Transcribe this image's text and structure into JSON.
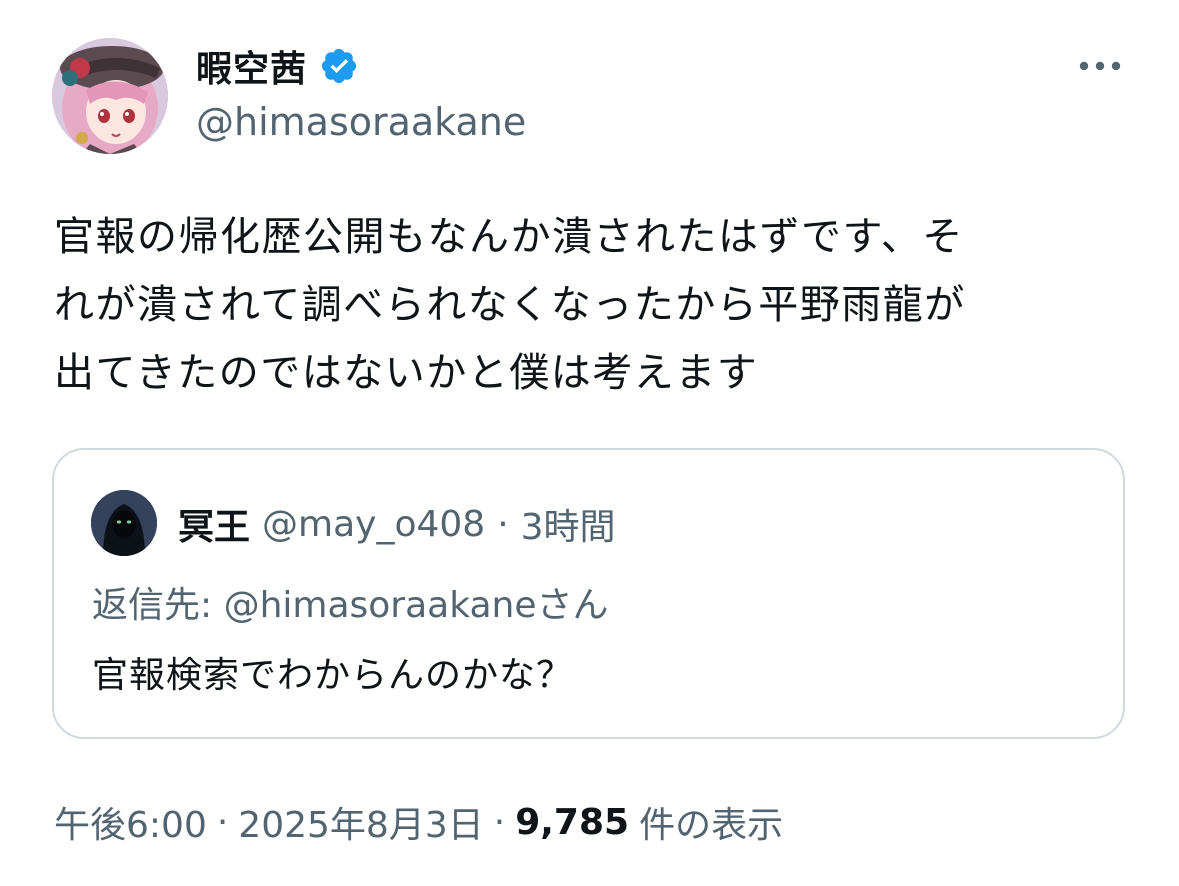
{
  "author": {
    "display_name": "暇空茜",
    "handle": "@himasoraakane",
    "verified": true,
    "avatar_icon": "anime-character-avatar",
    "verified_icon": "verified-badge-icon",
    "verified_color": "#1d9bf0"
  },
  "more_icon": "more-options-icon",
  "tweet": {
    "lines": [
      "官報の帰化歴公開もなんか潰されたはずです、そ",
      "れが潰されて調べられなくなったから平野雨龍が",
      "出てきたのではないかと僕は考えます"
    ]
  },
  "quote": {
    "display_name": "冥王",
    "handle": "@may_o408",
    "separator": "·",
    "time": "3時間",
    "avatar_icon": "dark-hooded-figure-avatar",
    "reply_to": "返信先: @himasoraakaneさん",
    "text": "官報検索でわからんのかな？"
  },
  "meta": {
    "time": "午後6:00",
    "sep1": "·",
    "date": "2025年8月3日",
    "sep2": "·",
    "views_count": "9,785",
    "views_label": "件の表示"
  },
  "colors": {
    "text": "#0f1419",
    "secondary": "#536471",
    "border": "#cfd9de",
    "accent": "#1d9bf0"
  }
}
